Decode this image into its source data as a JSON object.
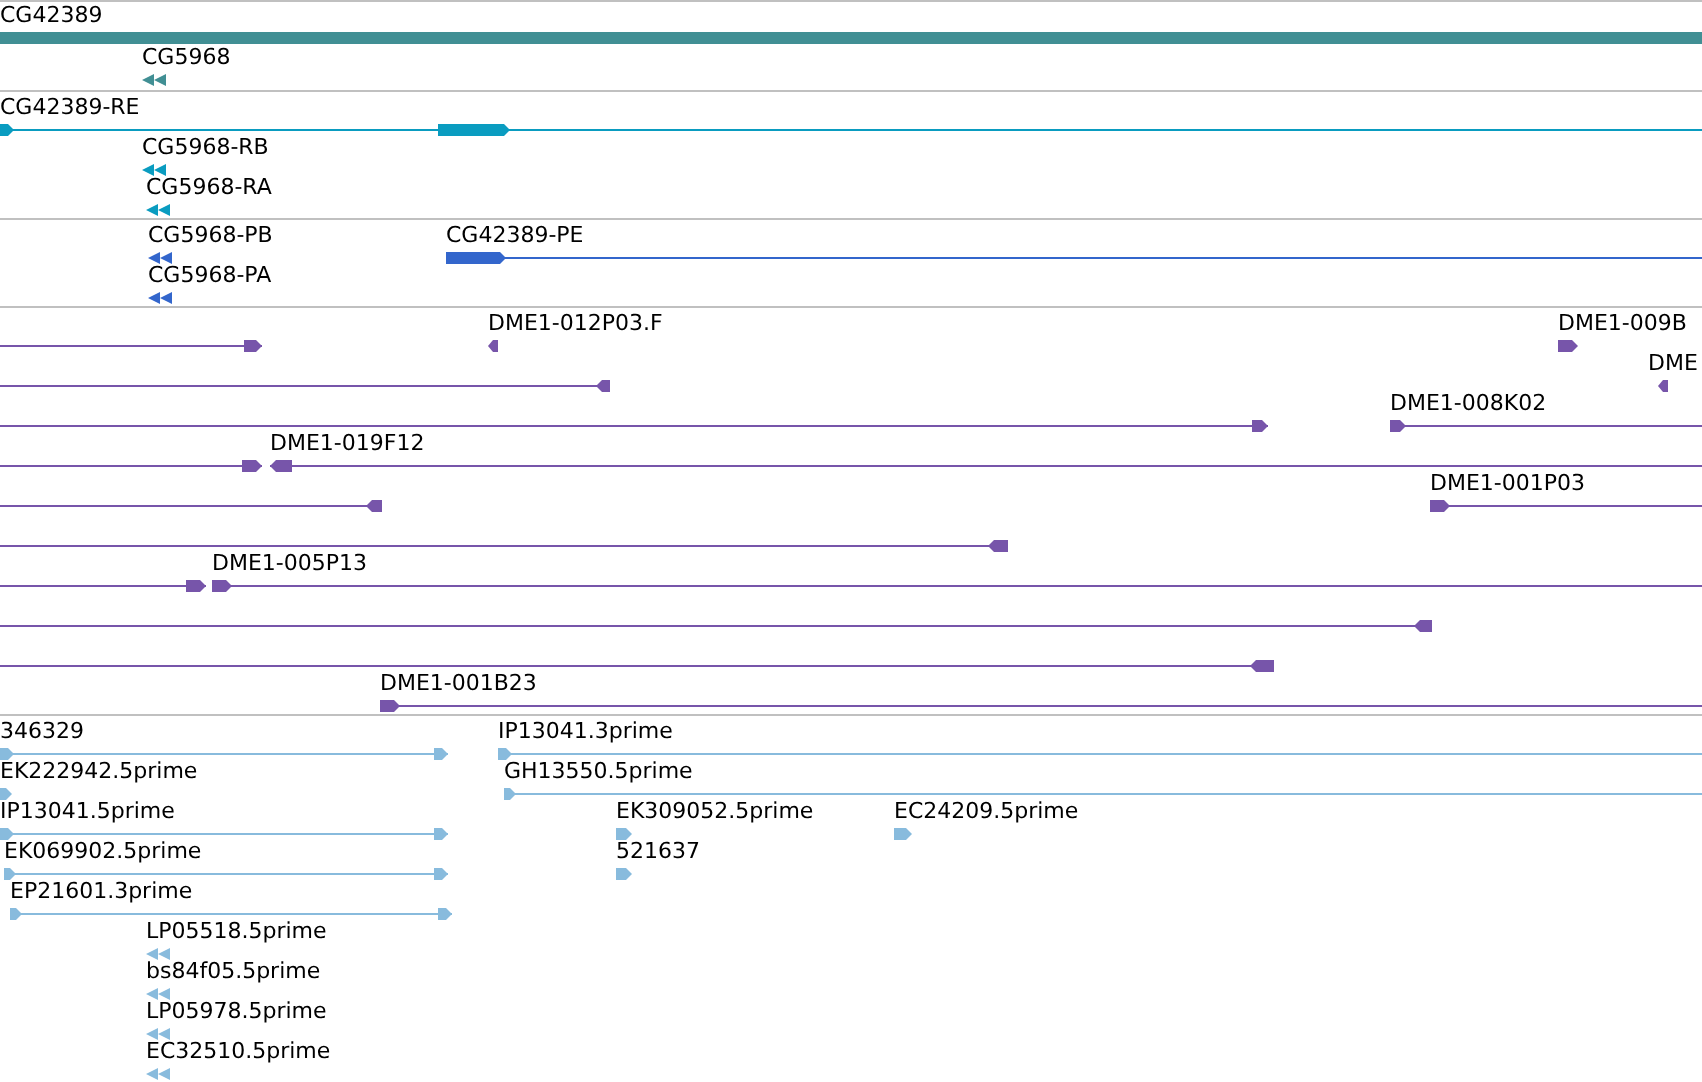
{
  "tracks": [
    {
      "color": "#418f94",
      "features": [
        {
          "label": "CG42389"
        },
        {
          "label": "CG5968",
          "reverse": true
        }
      ]
    },
    {
      "color": "#0a9cc0",
      "features": [
        {
          "label": "CG42389-RE",
          "reverse": false
        },
        {
          "label": "CG5968-RB",
          "reverse": true
        },
        {
          "label": "CG5968-RA",
          "reverse": true
        }
      ]
    },
    {
      "color": "#3366cc",
      "features": [
        {
          "label": "CG5968-PB",
          "reverse": true
        },
        {
          "label": "CG42389-PE",
          "reverse": false
        },
        {
          "label": "CG5968-PA",
          "reverse": true
        }
      ]
    },
    {
      "color": "#7755aa",
      "features": [
        {
          "reverse": false
        },
        {
          "label": "DME1-012P03.F",
          "reverse": true
        },
        {
          "label": "DME1-009B",
          "reverse": false
        },
        {
          "reverse": true
        },
        {
          "label": "DME",
          "reverse": true
        },
        {
          "reverse": false
        },
        {
          "label": "DME1-008K02",
          "reverse": false
        },
        {
          "reverse": false
        },
        {
          "label": "DME1-019F12",
          "reverse": true
        },
        {
          "reverse": true
        },
        {
          "label": "DME1-001P03",
          "reverse": false
        },
        {
          "reverse": true
        },
        {
          "reverse": false
        },
        {
          "label": "DME1-005P13",
          "reverse": false
        },
        {
          "reverse": true
        },
        {
          "reverse": true
        },
        {
          "label": "DME1-001B23",
          "reverse": false
        }
      ]
    },
    {
      "color": "#88bbdd",
      "features": [
        {
          "label": "346329",
          "reverse": false
        },
        {
          "label": "IP13041.3prime",
          "reverse": false
        },
        {
          "label": "EK222942.5prime",
          "reverse": false
        },
        {
          "label": "GH13550.5prime",
          "reverse": false
        },
        {
          "label": "IP13041.5prime",
          "reverse": false
        },
        {
          "label": "EK309052.5prime",
          "reverse": false
        },
        {
          "label": "EC24209.5prime",
          "reverse": false
        },
        {
          "label": "EK069902.5prime",
          "reverse": false
        },
        {
          "label": "521637",
          "reverse": false
        },
        {
          "label": "EP21601.3prime",
          "reverse": false
        },
        {
          "label": "LP05518.5prime",
          "reverse": true
        },
        {
          "label": "bs84f05.5prime",
          "reverse": true
        },
        {
          "label": "LP05978.5prime",
          "reverse": true
        },
        {
          "label": "EC32510.5prime",
          "reverse": true
        }
      ]
    }
  ]
}
